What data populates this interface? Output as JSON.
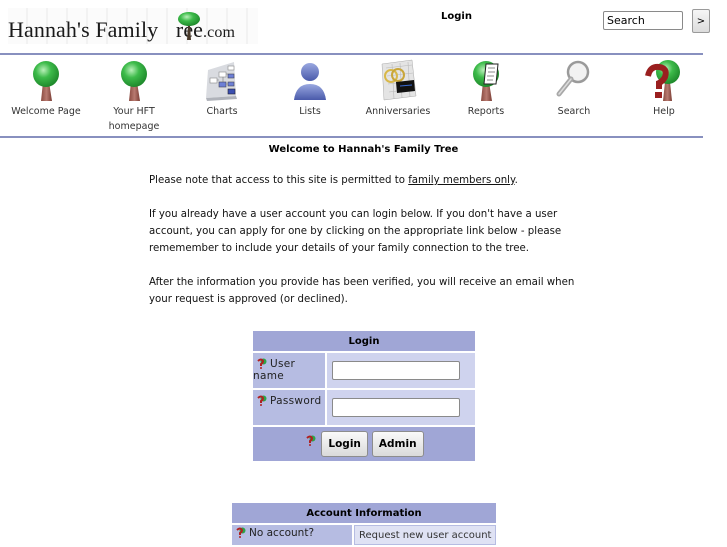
{
  "header": {
    "logo_text": "Hannah's Family ",
    "logo_text_tree_letter": "ree",
    "logo_dotcom": ".com",
    "page_title": "Login",
    "search_placeholder": "Search",
    "search_value": "Search",
    "search_button_label": ">"
  },
  "nav": {
    "items": [
      {
        "label": "Welcome Page",
        "icon": "tree-icon"
      },
      {
        "label": "Your HFT homepage",
        "icon": "tree-icon"
      },
      {
        "label": "Charts",
        "icon": "chart-icon"
      },
      {
        "label": "Lists",
        "icon": "person-icon"
      },
      {
        "label": "Anniversaries",
        "icon": "rings-calendar-icon"
      },
      {
        "label": "Reports",
        "icon": "tree-report-icon"
      },
      {
        "label": "Search",
        "icon": "magnifier-icon"
      },
      {
        "label": "Help",
        "icon": "tree-help-icon"
      }
    ]
  },
  "welcome": {
    "title": "Welcome to Hannah's Family Tree",
    "p1_prefix": "Please note that access to this site is permitted to ",
    "p1_link": "family members only",
    "p1_suffix": ".",
    "p2": "If you already have a user account you can login below. If you don't have a user account, you can apply for one by clicking on the appropriate link below - please rememember to include your details of your family connection to the tree.",
    "p3": "After the information you provide has been verified, you will receive an email when your request is approved (or declined)."
  },
  "login": {
    "title": "Login",
    "username_label": "User name",
    "username_value": "",
    "password_label": "Password",
    "password_value": "",
    "login_button": "Login",
    "admin_button": "Admin"
  },
  "account": {
    "title": "Account Information",
    "no_account_label": "No account?",
    "request_link": "Request new user account"
  },
  "colors": {
    "table_header": "#a0a6d6",
    "label_cell": "#b6bce2",
    "field_cell": "#cfd3ee",
    "rule": "#8890bf"
  }
}
